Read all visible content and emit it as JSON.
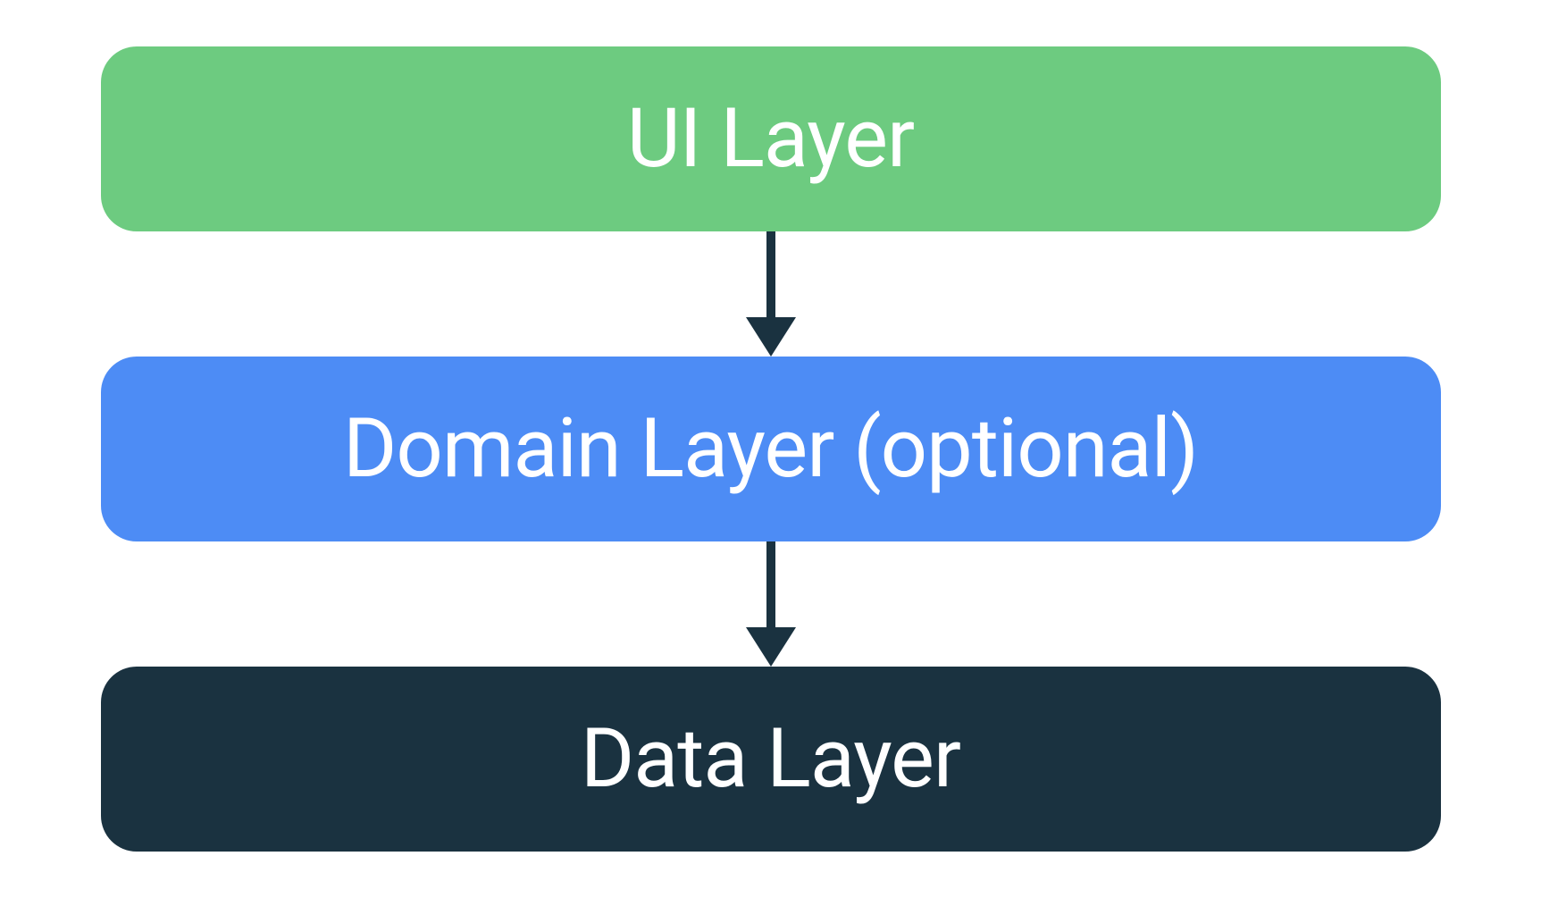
{
  "layers": {
    "ui": {
      "label": "UI Layer",
      "color": "#6dcb80"
    },
    "domain": {
      "label": "Domain Layer (optional)",
      "color": "#4d8cf5"
    },
    "data": {
      "label": "Data Layer",
      "color": "#1a3240"
    }
  },
  "arrow_color": "#1a3240"
}
